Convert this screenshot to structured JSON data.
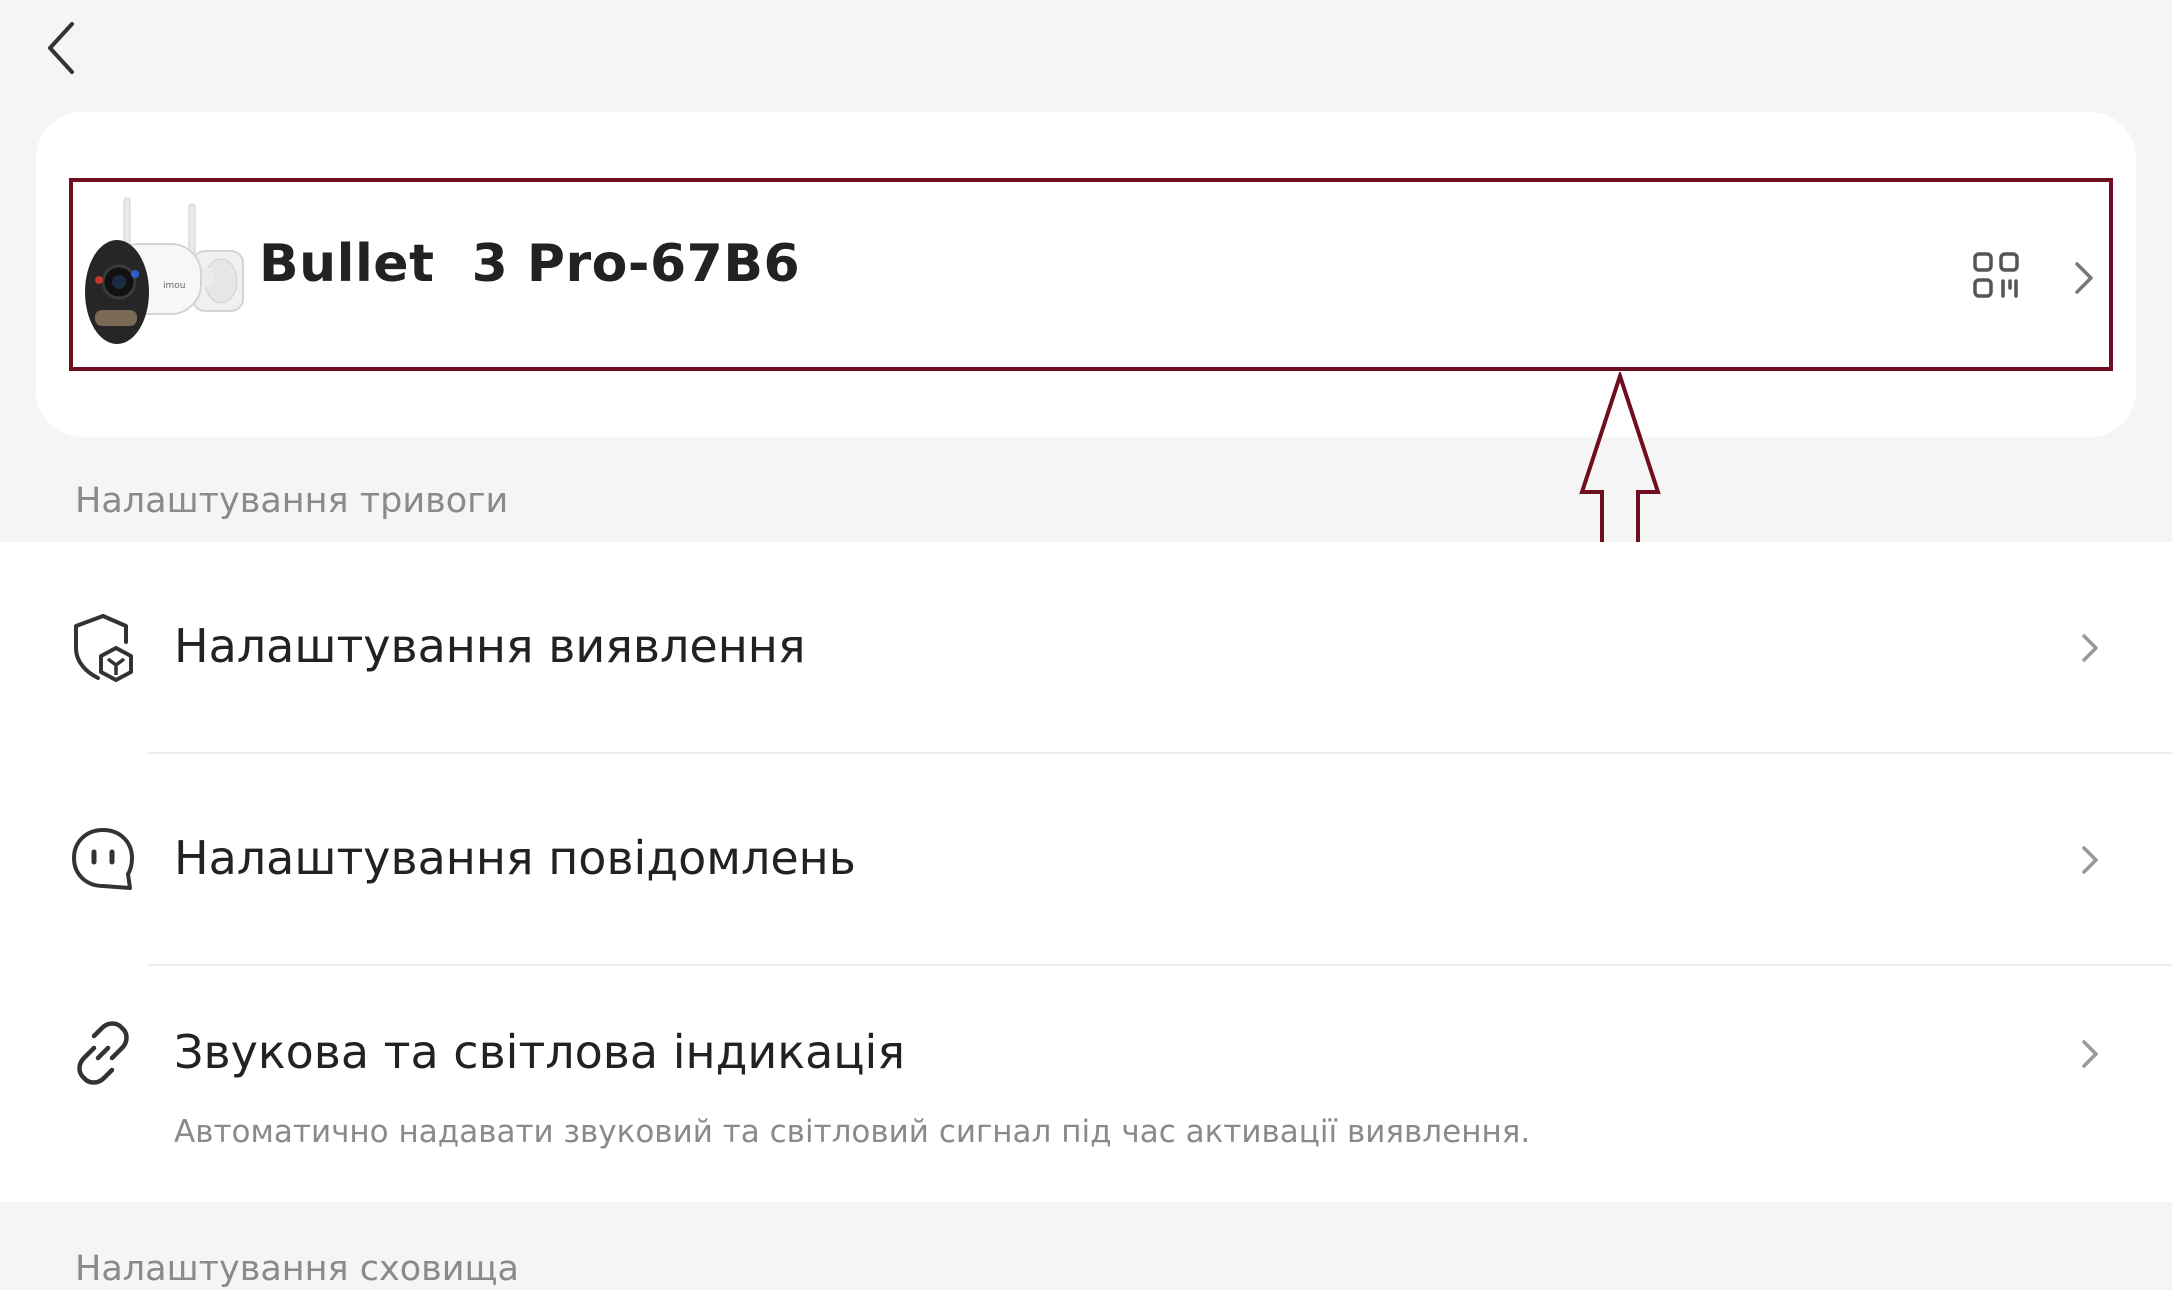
{
  "header": {
    "back_icon": "chevron-left-icon"
  },
  "device": {
    "name": "Bullet  3 Pro-67B6",
    "image_icon": "camera-image",
    "qr_icon": "qr-code-icon",
    "chevron_icon": "chevron-right-icon"
  },
  "sections": {
    "alarm": {
      "title": "Налаштування тривоги"
    },
    "storage": {
      "title": "Налаштування сховища"
    }
  },
  "alarm_items": [
    {
      "label": "Налаштування виявлення",
      "icon": "shield-detection-icon"
    },
    {
      "label": "Налаштування повідомлень",
      "icon": "chat-bubble-icon"
    },
    {
      "label": "Звукова та світлова індикація",
      "icon": "link-icon",
      "description": "Автоматично надавати звуковий та світловий сигнал під час активації виявлення."
    }
  ],
  "annotation": {
    "highlight_color": "#6e0f1f",
    "arrow_color": "#6e0f1f"
  }
}
